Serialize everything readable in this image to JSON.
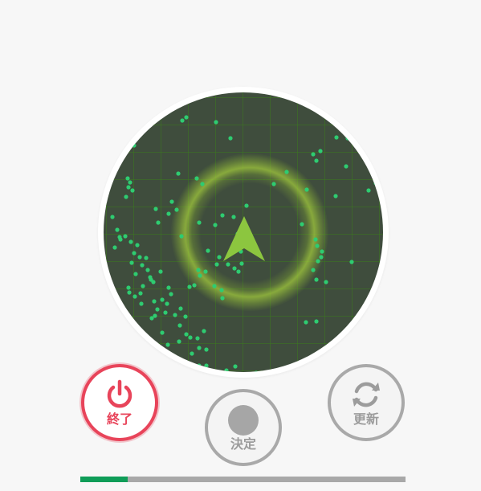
{
  "radar": {
    "arrow_color": "#8cc63f",
    "dot_color": "#2ecc71",
    "background_color": "#3f4d3d",
    "grid_color": "#3c781e"
  },
  "controls": {
    "end_label": "終了",
    "confirm_label": "決定",
    "refresh_label": "更新",
    "end_color": "#e8445a",
    "disabled_color": "#a9a9a9"
  },
  "progress": {
    "fraction": 0.145,
    "fill_color": "#0f9d58",
    "track_color": "#a8a8a8"
  }
}
